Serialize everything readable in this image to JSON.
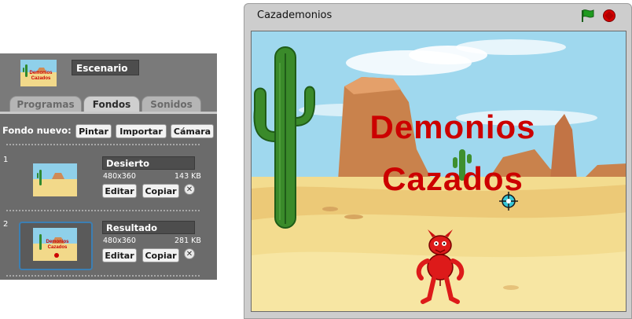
{
  "sprite_panel": {
    "stage_name": "Escenario",
    "tabs": [
      {
        "label": "Programas",
        "active": false
      },
      {
        "label": "Fondos",
        "active": true
      },
      {
        "label": "Sonidos",
        "active": false
      }
    ],
    "new_background": {
      "label": "Fondo nuevo:",
      "buttons": [
        "Pintar",
        "Importar",
        "Cámara"
      ]
    },
    "backgrounds": [
      {
        "number": "1",
        "name": "Desierto",
        "dimensions": "480x360",
        "size": "143 KB",
        "edit_label": "Editar",
        "copy_label": "Copiar",
        "delete_glyph": "✕",
        "selected": false
      },
      {
        "number": "2",
        "name": "Resultado",
        "dimensions": "480x360",
        "size": "281 KB",
        "edit_label": "Editar",
        "copy_label": "Copiar",
        "delete_glyph": "✕",
        "selected": true
      }
    ]
  },
  "stage": {
    "title": "Cazademonios",
    "text_line1": "Demonios",
    "text_line2": "Cazados",
    "text_color": "#cc0000"
  },
  "colors": {
    "panel_bg": "#6b6b6b",
    "selection_border": "#3c7fb3",
    "stop_red": "#d40000",
    "flag_green": "#1e9b1e"
  }
}
